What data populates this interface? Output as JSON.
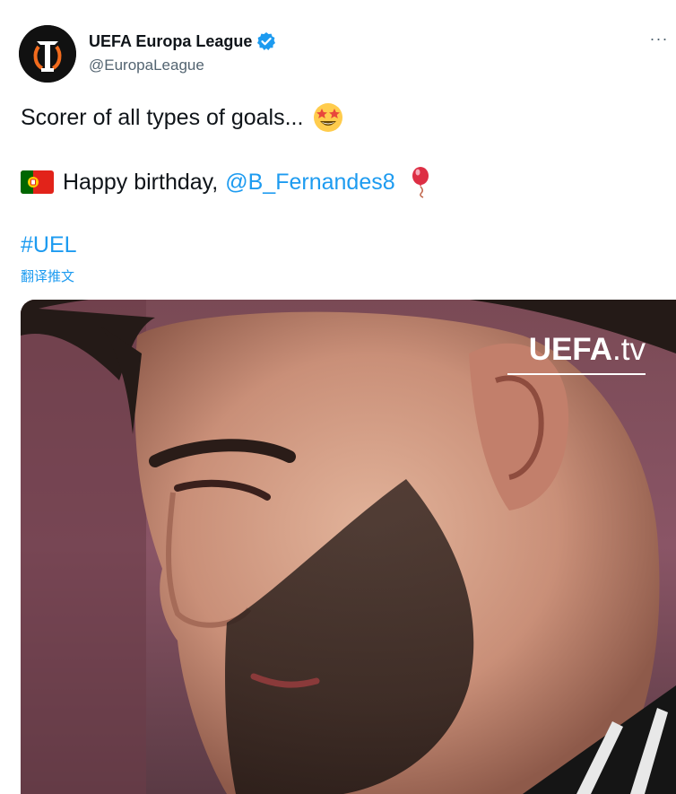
{
  "author": {
    "display_name": "UEFA Europa League",
    "handle": "@EuropaLeague",
    "verified": true,
    "avatar_icon": "europa-league-logo-icon"
  },
  "more_label": "···",
  "tweet": {
    "line1_text": "Scorer of all types of goals...",
    "line1_emoji": "star-struck-emoji",
    "line2_prefix": "Happy birthday,",
    "line2_mention": "@B_Fernandes8",
    "line2_flag": "portugal-flag-icon",
    "line2_emoji": "balloon-emoji",
    "hashtag": "#UEL",
    "translate_label": "翻译推文"
  },
  "media": {
    "watermark_brand": "UEFA",
    "watermark_suffix": ".tv",
    "description_icon": "player-photo"
  },
  "colors": {
    "link": "#1d9bf0",
    "text": "#0f1419",
    "secondary": "#536471",
    "verified": "#1d9bf0"
  }
}
